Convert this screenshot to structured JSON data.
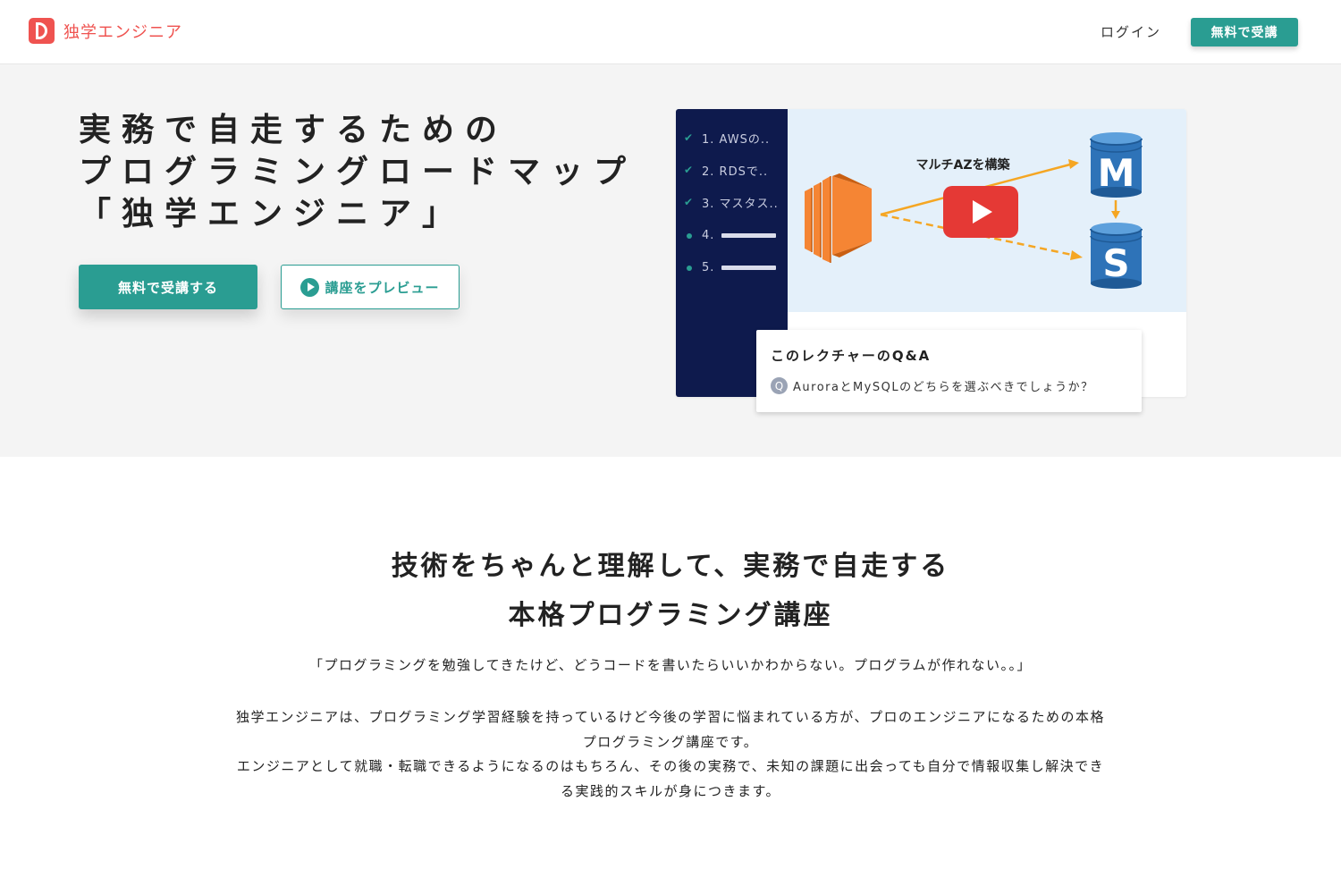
{
  "header": {
    "logo_text": "独学エンジニア",
    "login_label": "ログイン",
    "cta_label": "無料で受講"
  },
  "hero": {
    "title_lines": [
      "実務で自走するための",
      "プログラミングロードマップ",
      "「独学エンジニア」"
    ],
    "primary_button": "無料で受講する",
    "preview_button": "講座をプレビュー"
  },
  "preview": {
    "chapters": [
      {
        "label": "1. AWSの..",
        "done": true
      },
      {
        "label": "2. RDSで..",
        "done": true
      },
      {
        "label": "3. マスタス..",
        "done": true
      },
      {
        "label": "4.",
        "done": false
      },
      {
        "label": "5.",
        "done": false
      }
    ],
    "video_caption": "マルチAZを構築",
    "db_master_letter": "M",
    "db_slave_letter": "S",
    "qa_title": "このレクチャーのQ&A",
    "qa_badge": "Q",
    "qa_question": "AuroraとMySQLのどちらを選ぶべきでしょうか？"
  },
  "intro": {
    "heading_lines": [
      "技術をちゃんと理解して、実務で自走する",
      "本格プログラミング講座"
    ],
    "quote": "「プログラミングを勉強してきたけど、どうコードを書いたらいいかわからない。プログラムが作れない。。」",
    "body_lines": [
      "独学エンジニアは、プログラミング学習経験を持っているけど今後の学習に悩まれている方が、プロのエンジニアになるための本格",
      "プログラミング講座です。",
      "エンジニアとして就職・転職できるようになるのはもちろん、その後の実務で、未知の課題に出会っても自分で情報収集し解決でき",
      "る実践的スキルが身につきます。"
    ]
  },
  "colors": {
    "brand_red": "#ef5350",
    "accent_teal": "#2a9d92",
    "sidebar_navy": "#0e1a4d",
    "video_bg": "#e4f0fa",
    "ec2_orange": "#f58534",
    "db_blue": "#2e73b8",
    "arrow_orange": "#f5a623",
    "youtube_red": "#e53935"
  }
}
